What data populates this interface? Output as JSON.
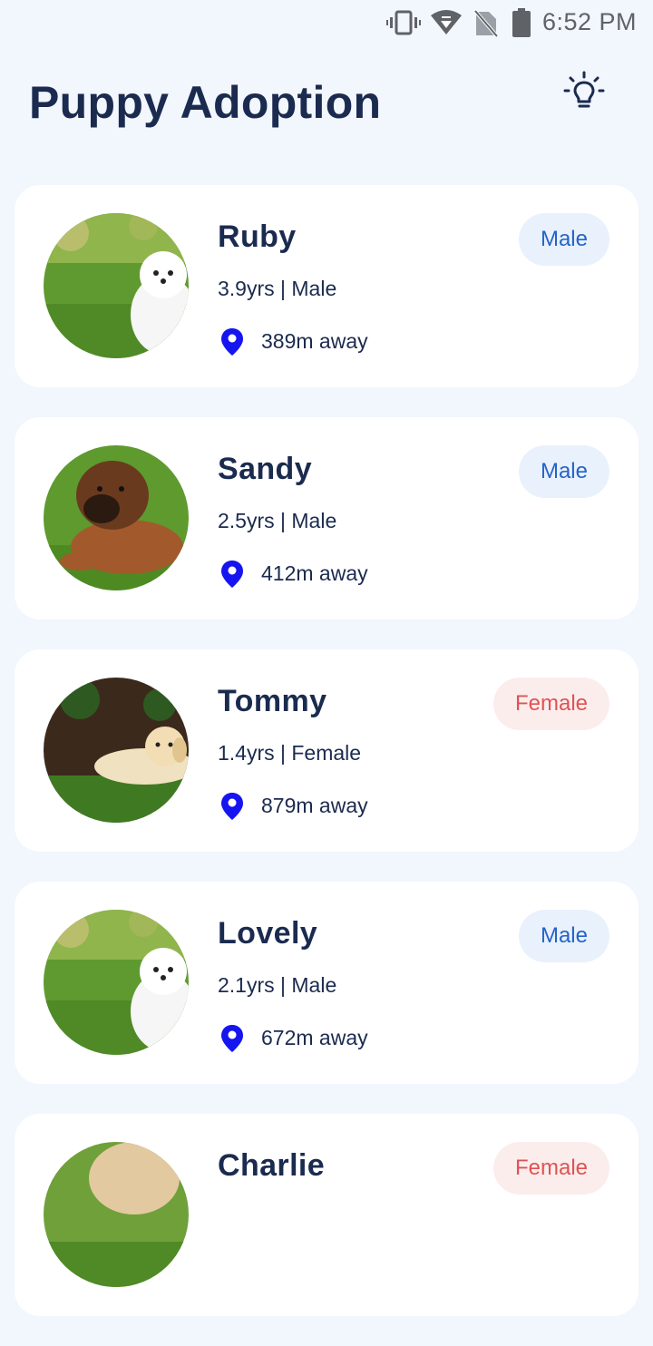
{
  "status_bar": {
    "time": "6:52 PM",
    "icons": [
      "vibrate-icon",
      "wifi-icon",
      "no-sim-icon",
      "battery-icon"
    ]
  },
  "header": {
    "title": "Puppy Adoption",
    "theme_icon": "lightbulb-icon"
  },
  "colors": {
    "background": "#F2F6FD",
    "card": "#FFFFFF",
    "title": "#1B2B4F",
    "male_badge_bg": "#E8F1FC",
    "male_badge_text": "#2563C9",
    "female_badge_bg": "#FCEDED",
    "female_badge_text": "#E05252",
    "pin": "#1515F0"
  },
  "puppies": [
    {
      "name": "Ruby",
      "meta": "3.9yrs | Male",
      "distance": "389m away",
      "badge": "Male",
      "photo": "white-puppy"
    },
    {
      "name": "Sandy",
      "meta": "2.5yrs | Male",
      "distance": "412m away",
      "badge": "Male",
      "photo": "brown-puppy"
    },
    {
      "name": "Tommy",
      "meta": "1.4yrs | Female",
      "distance": "879m away",
      "badge": "Female",
      "photo": "golden-puppy"
    },
    {
      "name": "Lovely",
      "meta": "2.1yrs | Male",
      "distance": "672m away",
      "badge": "Male",
      "photo": "white-puppy"
    },
    {
      "name": "Charlie",
      "meta": "",
      "distance": "",
      "badge": "Female",
      "photo": "tan-puppy"
    }
  ]
}
